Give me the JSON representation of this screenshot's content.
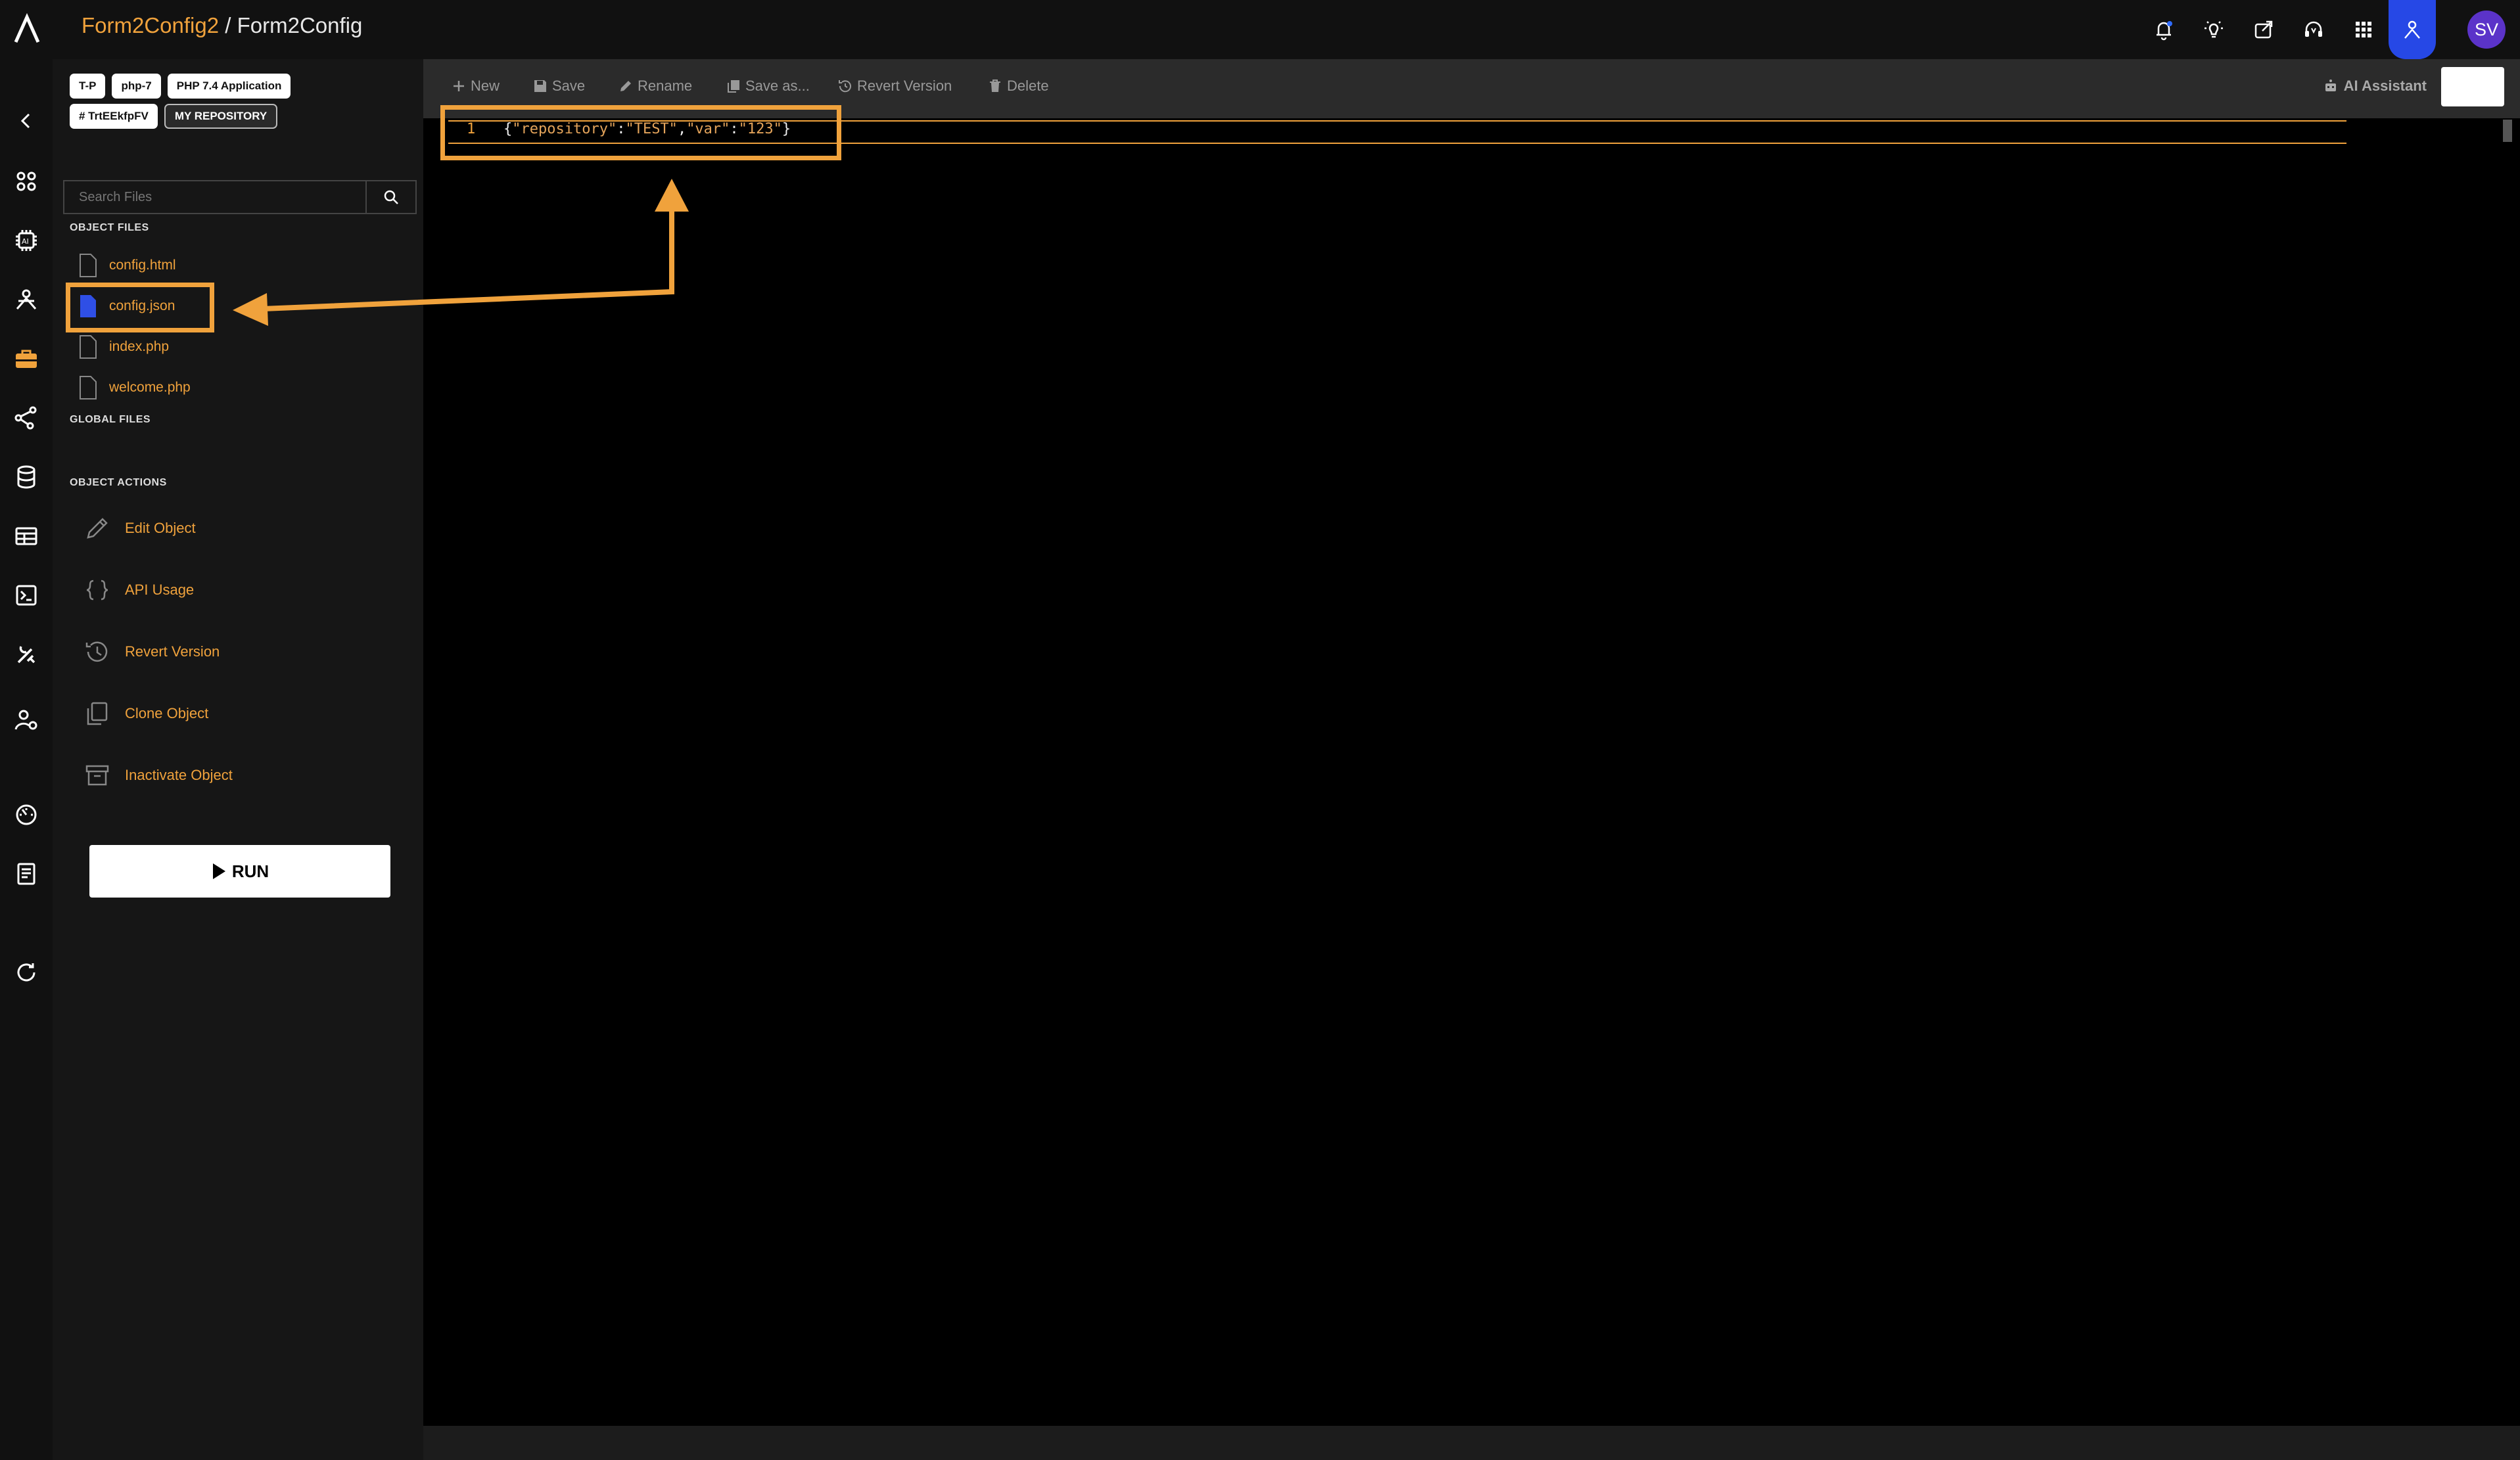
{
  "header": {
    "project": "Form2Config2",
    "separator": " / ",
    "object": "Form2Config",
    "user_initials": "SV"
  },
  "sidebar": {
    "chips": [
      "T-P",
      "php-7",
      "PHP 7.4 Application",
      "# TrtEEkfpFV",
      "MY REPOSITORY"
    ],
    "search_placeholder": "Search Files",
    "object_files_title": "OBJECT FILES",
    "files": [
      "config.html",
      "config.json",
      "index.php",
      "welcome.php"
    ],
    "selected_file": "config.json",
    "global_files_title": "GLOBAL FILES",
    "object_actions_title": "OBJECT ACTIONS",
    "actions": [
      "Edit Object",
      "API Usage",
      "Revert Version",
      "Clone Object",
      "Inactivate Object"
    ],
    "run_label": "RUN"
  },
  "toolbar": {
    "new": "New",
    "save": "Save",
    "rename": "Rename",
    "save_as": "Save as...",
    "revert": "Revert Version",
    "delete": "Delete",
    "ai_assistant": "AI Assistant"
  },
  "editor": {
    "line_number": "1",
    "code_open": "{",
    "key1": "\"repository\"",
    "colon": ":",
    "val1": "\"TEST\"",
    "comma": ",",
    "key2": "\"var\"",
    "val2": "\"123\"",
    "code_close": "}"
  },
  "colors": {
    "accent": "#f0a23c",
    "active_blue": "#2648e6",
    "avatar": "#5b33c9"
  }
}
